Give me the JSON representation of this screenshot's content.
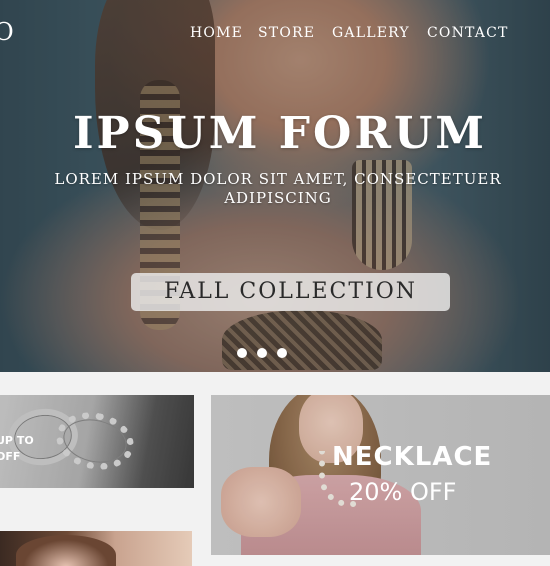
{
  "logo": {
    "text": "O"
  },
  "nav": {
    "items": [
      {
        "label": "HOME"
      },
      {
        "label": "STORE"
      },
      {
        "label": "GALLERY"
      },
      {
        "label": "CONTACT"
      }
    ]
  },
  "hero": {
    "title": "IPSUM FORUM",
    "subtitle": "LOREM IPSUM DOLOR SIT AMET, CONSECTETUER ADIPISCING",
    "cta_label": "FALL COLLECTION",
    "slides_total": 3
  },
  "promos": {
    "rings": {
      "label": "UP TO\nOFF"
    },
    "necklace": {
      "title": "NECKLACE",
      "offer": "20% OFF"
    }
  },
  "colors": {
    "cta_bg": "#ebebeb",
    "text_on_hero": "#ffffff"
  }
}
